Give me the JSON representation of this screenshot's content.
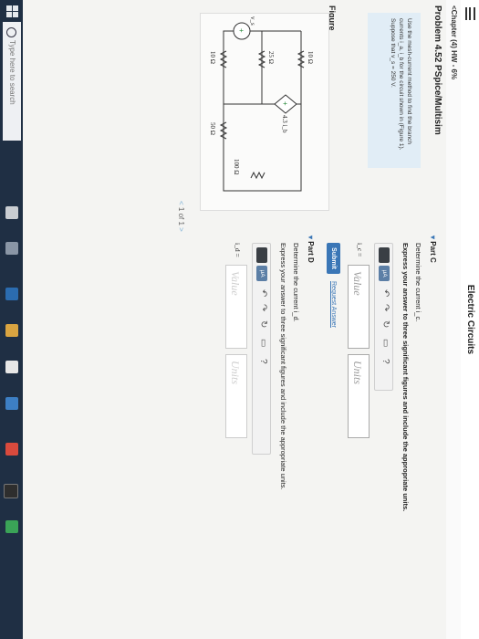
{
  "header": {
    "course_title": "Electric Circuits",
    "chapter_link": "<Chapter (4) HW - 6%",
    "problem_title": "Problem 4.52 PSpice/Multisim"
  },
  "statement": {
    "text": "Use the mesh-current method to find the branch currents i_a, i_b for the circuit shown in (Figure 1). Suppose that v_s = 250 V."
  },
  "figure": {
    "label": "Figure",
    "pager": "1 of 1",
    "pager_prev": "<",
    "pager_next": ">",
    "components": {
      "r1": "10 Ω",
      "r2": "25 Ω",
      "r3": "10 Ω",
      "r4": "50 Ω",
      "r5": "100 Ω",
      "dep_source": "4.3 i_b",
      "source": "v_s"
    }
  },
  "part_c": {
    "title": "Part C",
    "prompt": "Determine the current i_c.",
    "instructions": "Express your answer to three significant figures and include the appropriate units.",
    "var_label": "i_c =",
    "value_placeholder": "Value",
    "units_placeholder": "Units",
    "submit_label": "Submit",
    "request_label": "Request Answer"
  },
  "part_d": {
    "title": "Part D",
    "prompt": "Determine the current i_d.",
    "instructions": "Express your answer to three significant figures and include the appropriate units.",
    "var_label": "i_d =",
    "value_placeholder": "Value",
    "units_placeholder": "Units"
  },
  "toolbar": {
    "mu_label": "μA",
    "undo_icon": "undo-icon",
    "redo_icon": "redo-icon",
    "reset_icon": "reset-icon",
    "keyboard_icon": "keyboard-icon",
    "help_label": "?"
  },
  "taskbar": {
    "search_placeholder": "Type here to search"
  },
  "colors": {
    "accent": "#3a76b6",
    "statement_bg": "#e1edf6",
    "taskbar": "#1f2f44"
  }
}
